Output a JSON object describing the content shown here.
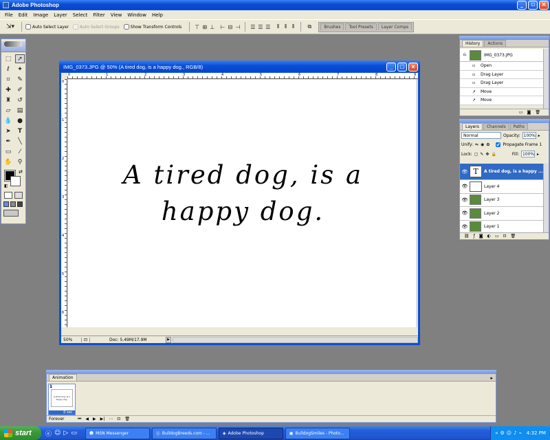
{
  "app": {
    "title": "Adobe Photoshop"
  },
  "menu": [
    "File",
    "Edit",
    "Image",
    "Layer",
    "Select",
    "Filter",
    "View",
    "Window",
    "Help"
  ],
  "options": {
    "auto_select_layer": "Auto Select Layer",
    "auto_select_groups": "Auto Select Groups",
    "show_transform_controls": "Show Transform Controls"
  },
  "dock_tabs": [
    "Brushes",
    "Tool Presets",
    "Layer Comps"
  ],
  "document": {
    "title": "IMG_0373.JPG @ 50% (A tired dog, is a happy dog., RGB/8)",
    "text_line1": "A tired dog, is a",
    "text_line2": "happy dog.",
    "zoom": "50%",
    "doc_info": "Doc: 5.49M/17.9M",
    "ruler_top": [
      "0",
      "1",
      "2",
      "3",
      "4",
      "5",
      "6",
      "7",
      "8",
      "9"
    ],
    "ruler_left": [
      "0",
      "1",
      "2",
      "3",
      "4",
      "5",
      "6"
    ]
  },
  "history": {
    "tabs": [
      "History",
      "Actions"
    ],
    "snapshot": "IMG_0373.JPG",
    "items": [
      "Open",
      "Drag Layer",
      "Drag Layer",
      "Move",
      "Move"
    ]
  },
  "layers": {
    "tabs": [
      "Layers",
      "Channels",
      "Paths"
    ],
    "blend_mode": "Normal",
    "opacity_label": "Opacity:",
    "opacity": "100%",
    "unify_label": "Unify:",
    "propagate": "Propagate Frame 1",
    "lock_label": "Lock:",
    "fill_label": "Fill:",
    "fill": "100%",
    "items": [
      {
        "name": "A tired dog, is a happy ...",
        "thumb": "T"
      },
      {
        "name": "Layer 4",
        "thumb": ""
      },
      {
        "name": "Layer 3",
        "thumb": ""
      },
      {
        "name": "Layer 2",
        "thumb": ""
      },
      {
        "name": "Layer 1",
        "thumb": ""
      }
    ]
  },
  "animation": {
    "title": "Animation",
    "frame_number": "1",
    "frame_delay": "0 sec.",
    "loop": "Forever",
    "frame_thumb_text": "A tired dog, is a happy dog."
  },
  "taskbar": {
    "start": "start",
    "items": [
      "MSN Messenger",
      "BulldogBreeds.com - ...",
      "Adobe Photoshop",
      "BulldogSmiles - Photo..."
    ],
    "clock": "4:32 PM"
  },
  "colors": {
    "xp_blue": "#0a4fd8",
    "selected_layer": "#316ac5",
    "taskbar": "#245edb",
    "start_green": "#3c9a3c"
  }
}
